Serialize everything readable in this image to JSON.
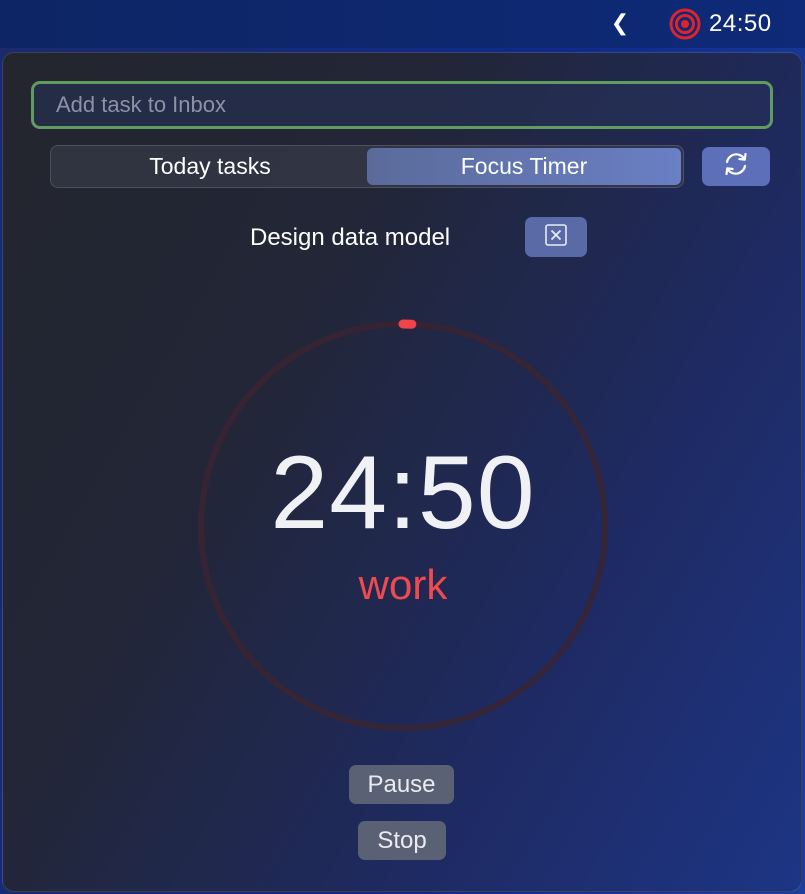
{
  "menubar": {
    "chevron": "❮",
    "tray_time": "24:50",
    "tray_icon": "target-icon"
  },
  "task_input": {
    "placeholder": "Add task to Inbox",
    "value": ""
  },
  "tabs": [
    {
      "label": "Today tasks",
      "active": false
    },
    {
      "label": "Focus Timer",
      "active": true
    }
  ],
  "refresh_icon": "refresh-icon",
  "current_task": {
    "name": "Design data model",
    "clear_icon": "close-box-icon"
  },
  "timer": {
    "time": "24:50",
    "mode": "work",
    "progress": 0.007
  },
  "controls": {
    "pause_label": "Pause",
    "stop_label": "Stop"
  },
  "colors": {
    "accent_red": "#ef4a4f",
    "input_border": "#5f9c60",
    "active_tab": "#6a7fc4",
    "button": "#5a6174"
  }
}
